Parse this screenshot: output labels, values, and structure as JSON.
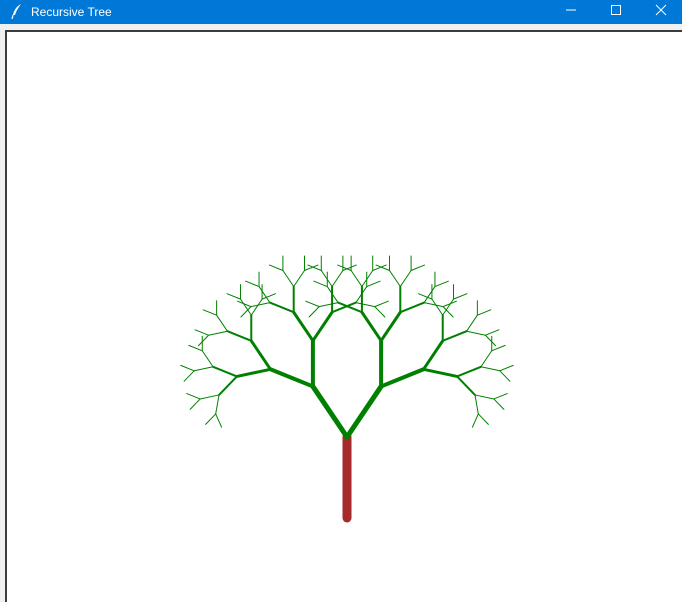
{
  "window": {
    "title": "Recursive Tree",
    "title_icon": "feather-icon",
    "titlebar_color": "#0078d7"
  },
  "controls": {
    "minimize_icon": "minimize-icon",
    "maximize_icon": "maximize-icon",
    "close_icon": "close-icon"
  },
  "canvas": {
    "background": "#ffffff",
    "trunk_color": "#a52a2a",
    "branch_color": "#008000",
    "branch_angle_degrees": 34,
    "recursion_depth": 6,
    "length_ratio": 0.75
  }
}
